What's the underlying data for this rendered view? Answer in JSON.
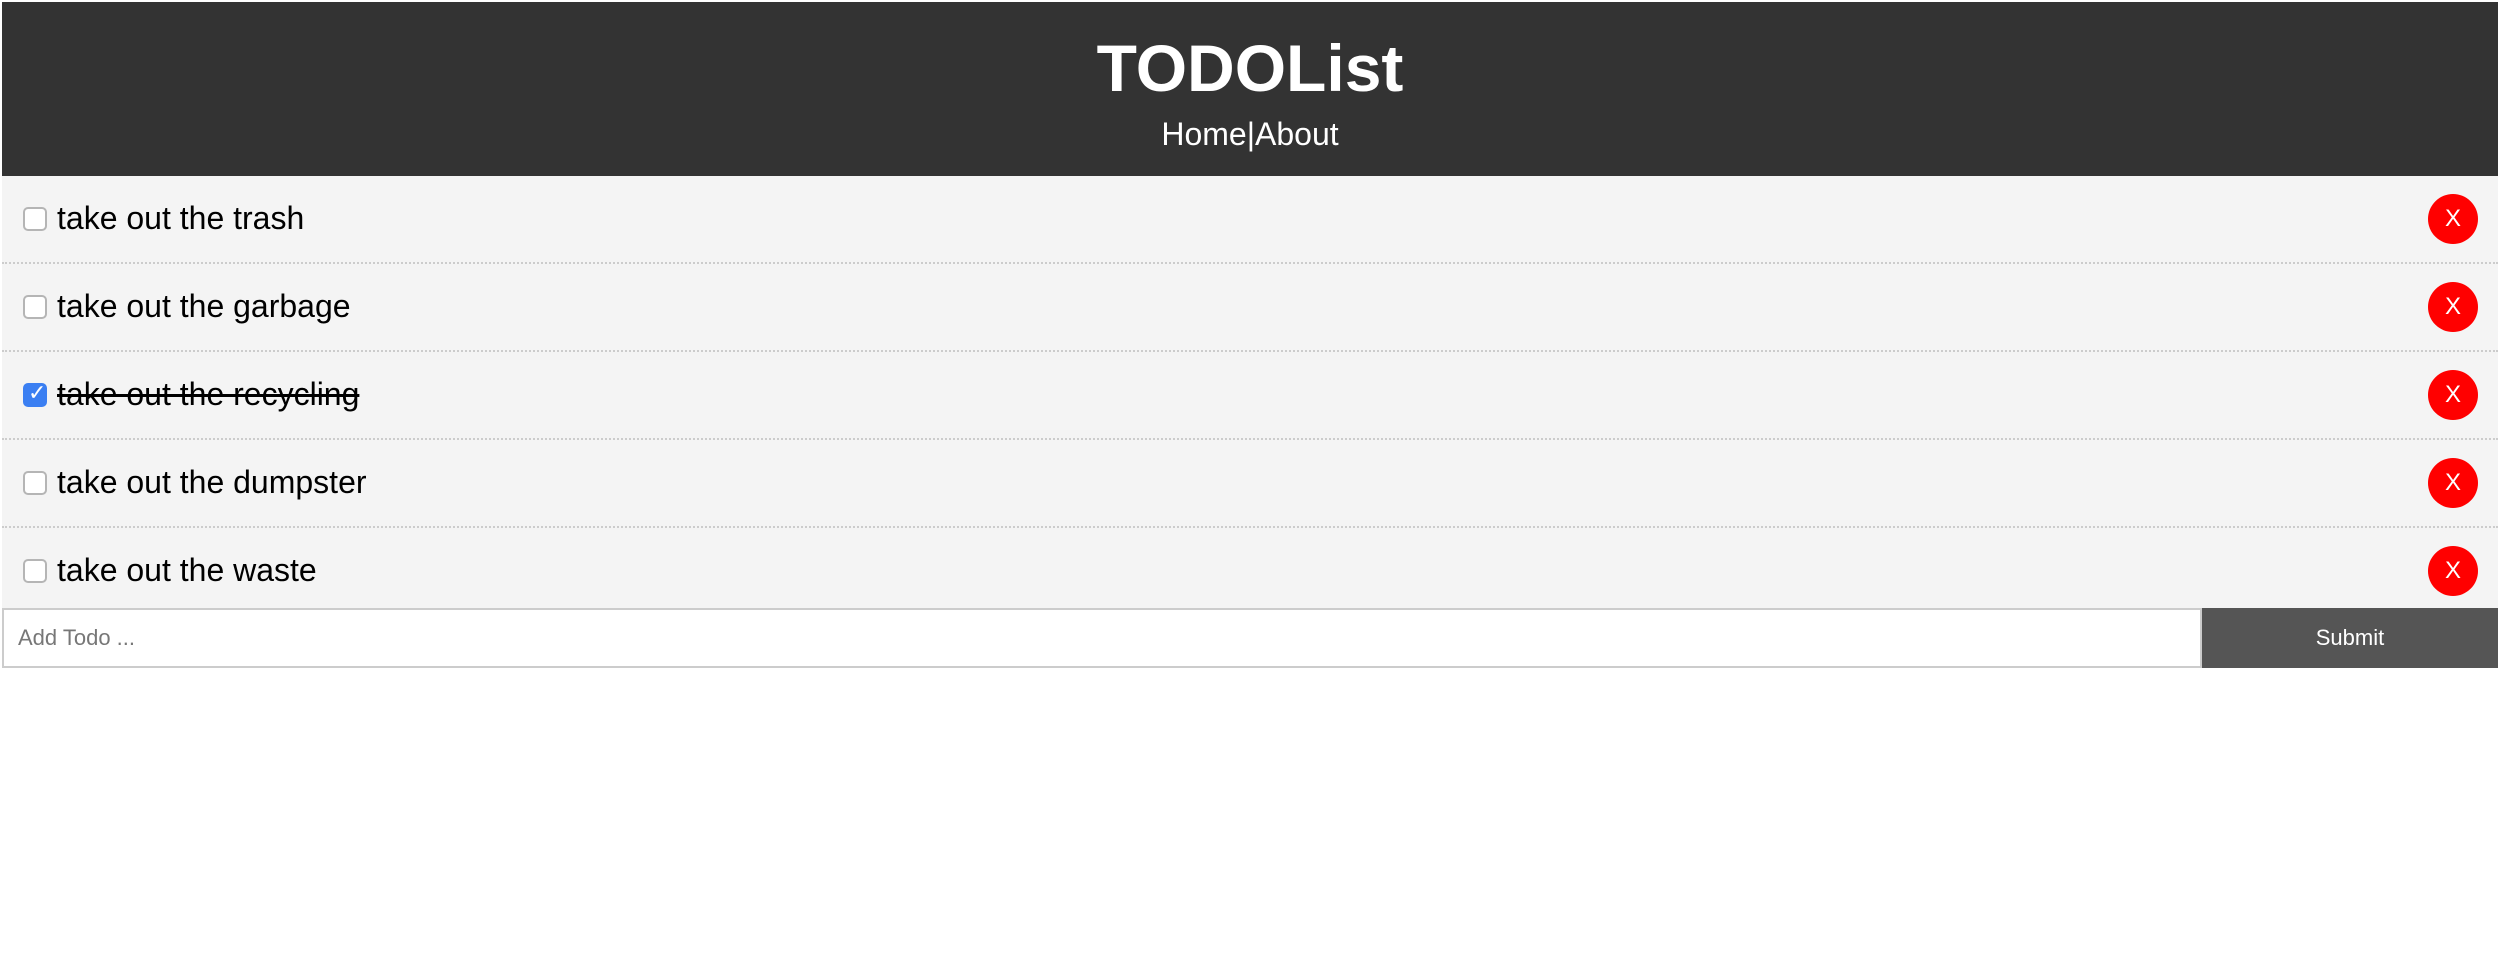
{
  "header": {
    "title": "TODOList",
    "nav": {
      "home": "Home",
      "separator": "|",
      "about": "About"
    }
  },
  "todos": [
    {
      "title": "take out the trash",
      "completed": false,
      "delete_label": "X"
    },
    {
      "title": "take out the garbage",
      "completed": false,
      "delete_label": "X"
    },
    {
      "title": "take out the recycling",
      "completed": true,
      "delete_label": "X"
    },
    {
      "title": "take out the dumpster",
      "completed": false,
      "delete_label": "X"
    },
    {
      "title": "take out the waste",
      "completed": false,
      "delete_label": "X"
    }
  ],
  "add_form": {
    "placeholder": "Add Todo ...",
    "value": "",
    "submit_label": "Submit"
  },
  "colors": {
    "header_bg": "#333333",
    "item_bg": "#f4f4f4",
    "delete_bg": "#ff0000",
    "submit_bg": "#555555",
    "checkbox_checked": "#3b7ff2"
  }
}
